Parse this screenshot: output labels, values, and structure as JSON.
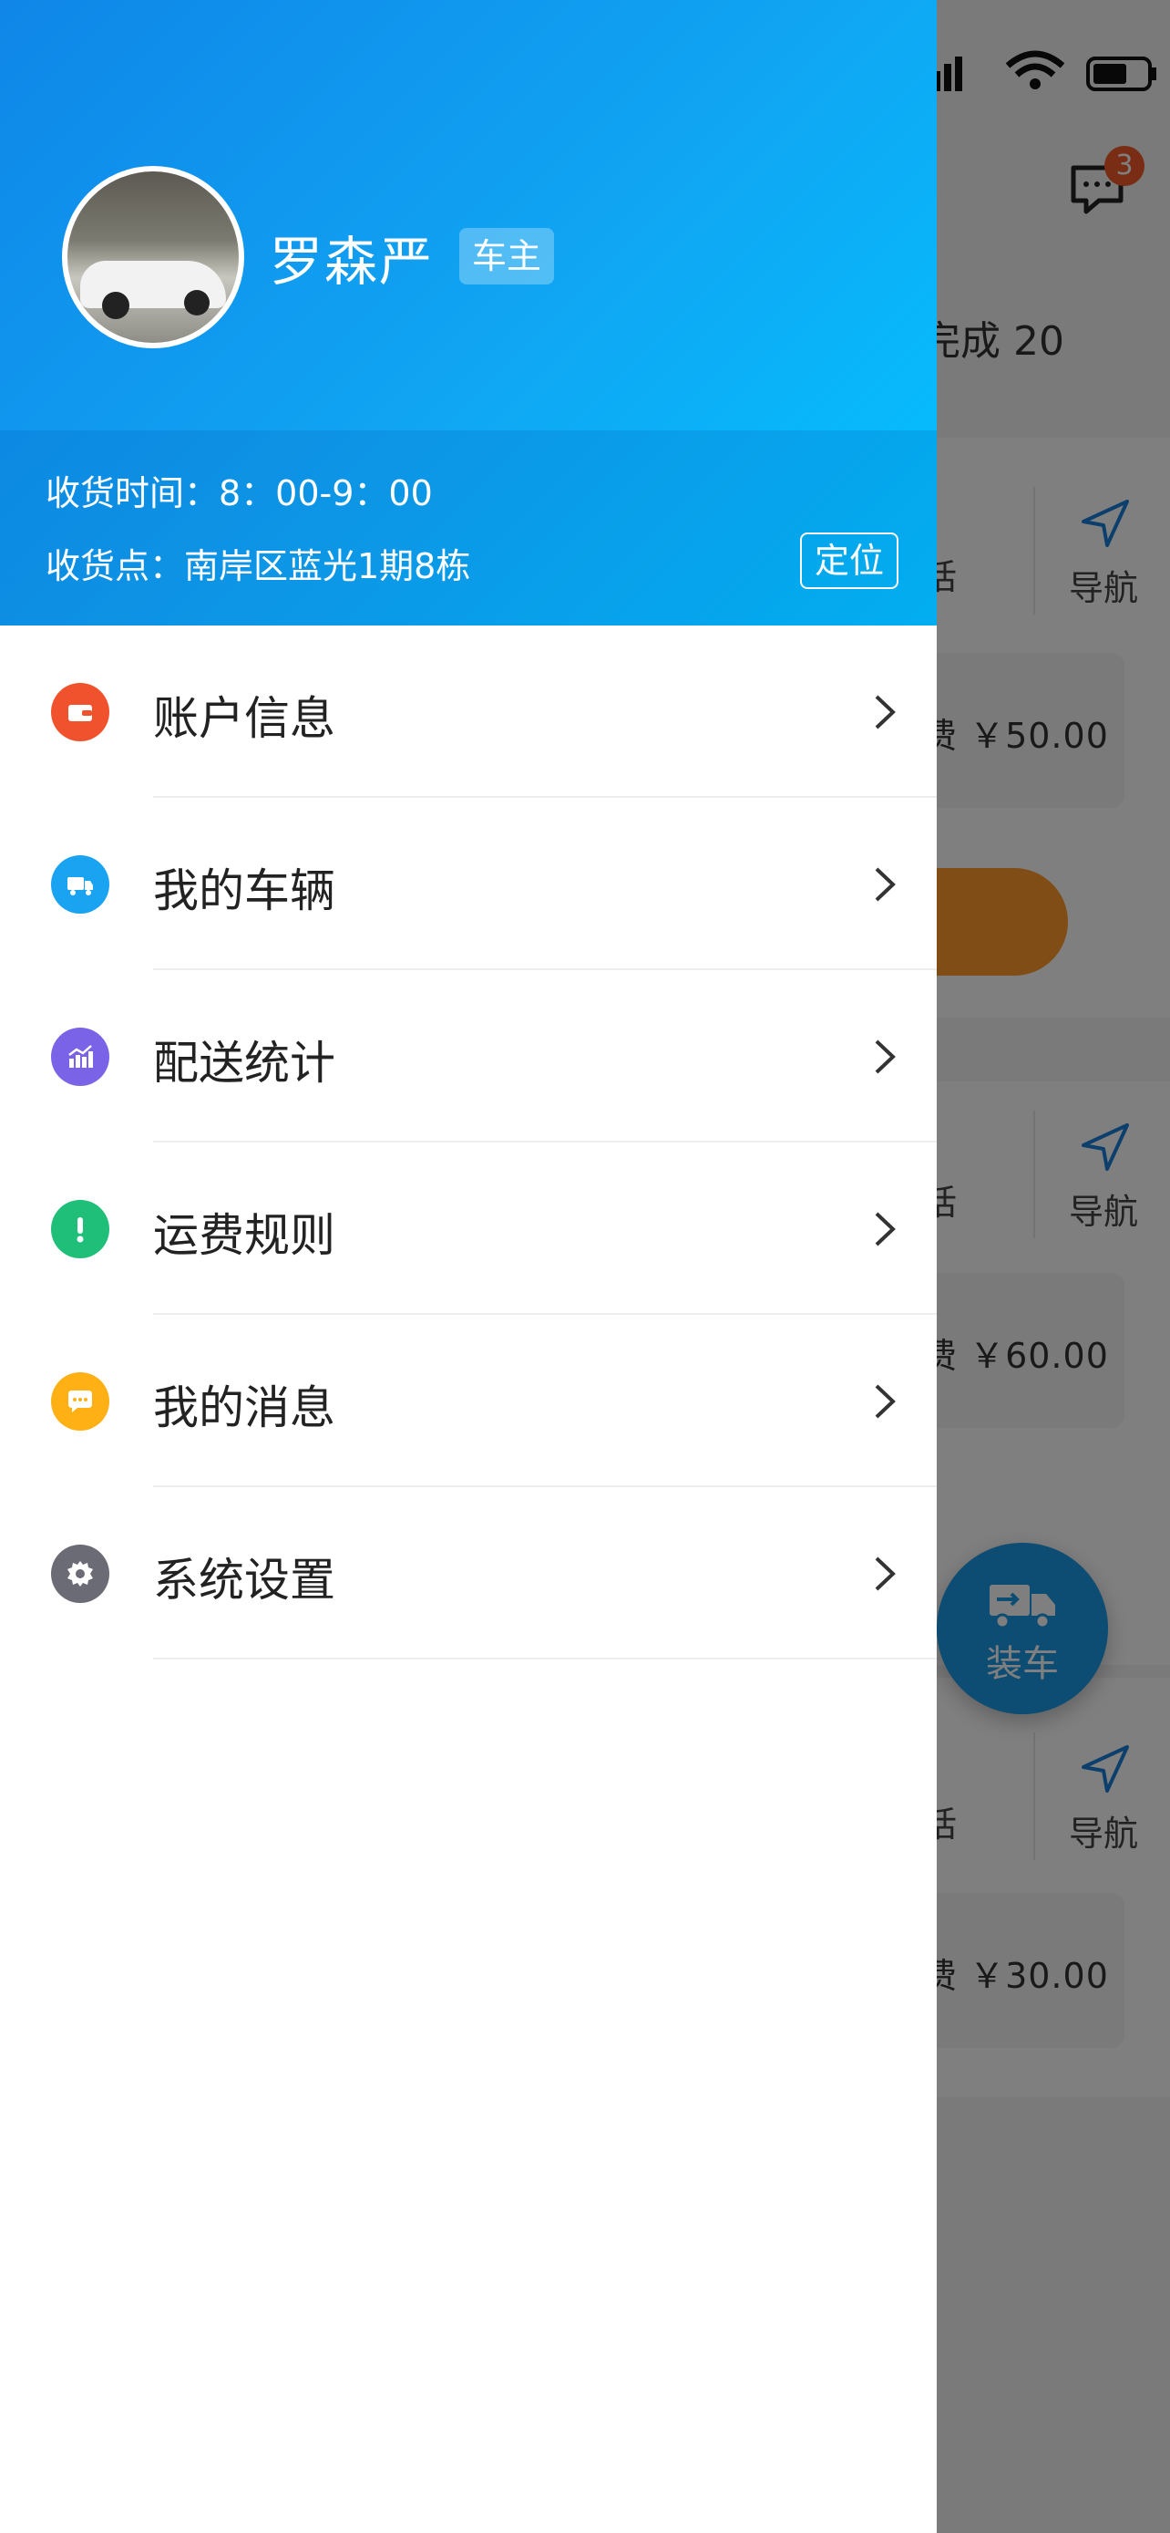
{
  "background": {
    "unread_count": "3",
    "completed_label": "完成 20",
    "cards": [
      {
        "call_fragment": "话",
        "nav_label": "导航",
        "fee_text": "费 ￥50.00"
      },
      {
        "call_fragment": "话",
        "nav_label": "导航",
        "fee_text": "费 ￥60.00"
      },
      {
        "call_fragment": "话",
        "nav_label": "导航",
        "fee_text": "费 ￥30.00"
      }
    ],
    "fab_label": "装车"
  },
  "drawer": {
    "user": {
      "name": "罗森严",
      "role": "车主"
    },
    "receive_time": "收货时间：8：00-9：00",
    "receive_point": "收货点：南岸区蓝光1期8栋",
    "locate_label": "定位",
    "menu": [
      {
        "label": "账户信息",
        "icon": "wallet-icon",
        "color": "#f0522e"
      },
      {
        "label": "我的车辆",
        "icon": "truck-icon",
        "color": "#1aa3f0"
      },
      {
        "label": "配送统计",
        "icon": "stats-icon",
        "color": "#7a63e6"
      },
      {
        "label": "运费规则",
        "icon": "exclamation-icon",
        "color": "#1fbf7a"
      },
      {
        "label": "我的消息",
        "icon": "chat-icon",
        "color": "#ffb014"
      },
      {
        "label": "系统设置",
        "icon": "gear-icon",
        "color": "#6b6b75"
      }
    ]
  },
  "colors": {
    "brand_blue": "#10a6f3",
    "accent_orange": "#ff9a2a",
    "badge_red": "#f05a28"
  }
}
